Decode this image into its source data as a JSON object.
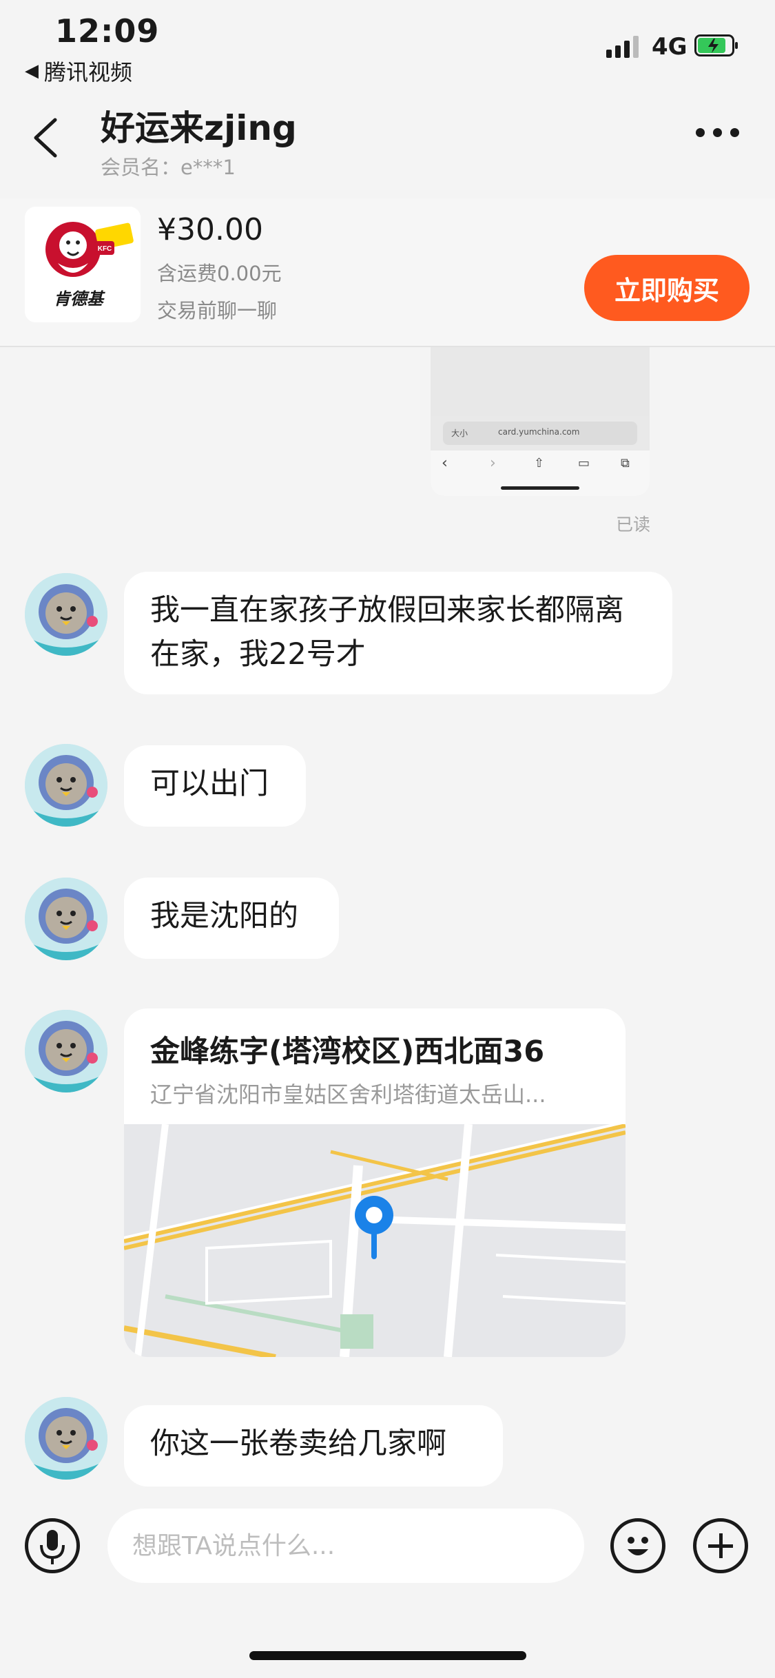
{
  "status_bar": {
    "time": "12:09",
    "back_app": "腾讯视频",
    "network": "4G"
  },
  "header": {
    "title": "好运来zjing",
    "subtitle": "会员名：e***1"
  },
  "product": {
    "thumb_brand": "肯德基",
    "thumb_badge": "肯德基",
    "price": "¥30.00",
    "shipping": "含运费0.00元",
    "note": "交易前聊一聊",
    "buy_label": "立即购买"
  },
  "shared_image": {
    "url_text": "card.yumchina.com",
    "size_text": "大小"
  },
  "read_status": "已读",
  "messages": [
    {
      "text": "我一直在家孩子放假回来家长都隔离在家，我22号才"
    },
    {
      "text": "可以出门"
    },
    {
      "text": "我是沈阳的"
    },
    {
      "text": "你这一张卷卖给几家啊"
    }
  ],
  "location": {
    "title": "金峰练字(塔湾校区)西北面36",
    "address": "辽宁省沈阳市皇姑区舍利塔街道太岳山..."
  },
  "input": {
    "placeholder": "想跟TA说点什么..."
  },
  "colors": {
    "accent": "#ff5a1f",
    "pin": "#1a82e8",
    "battery": "#34c759"
  }
}
